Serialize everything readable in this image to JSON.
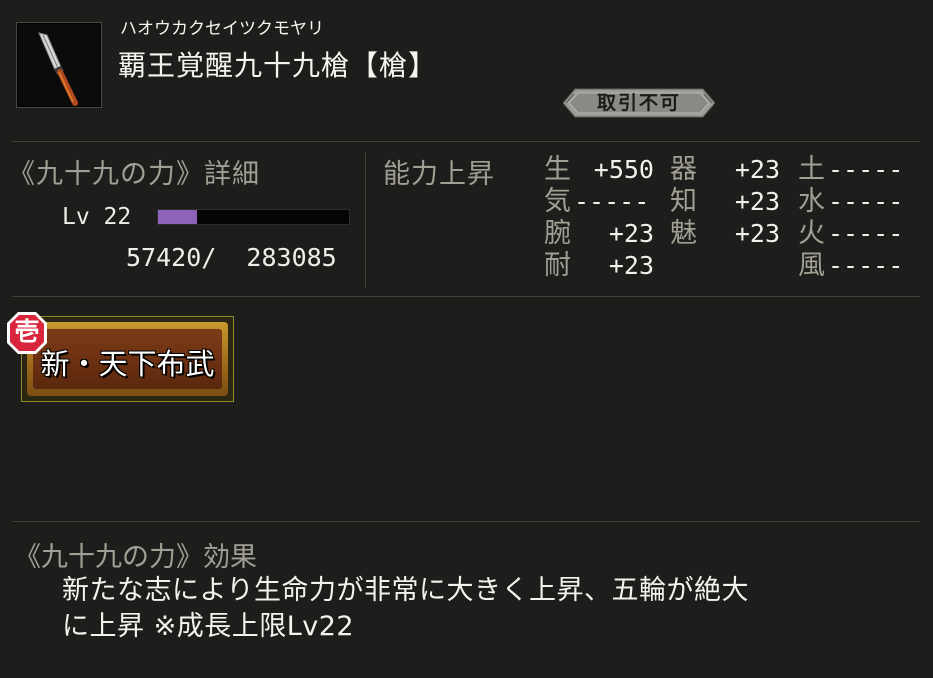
{
  "item": {
    "furigana": "ハオウカクセイツクモヤリ",
    "name": "覇王覚醒九十九槍【槍】",
    "icon": "spear-icon",
    "trade_status": "取引不可"
  },
  "power": {
    "title": "《九十九の力》詳細",
    "level_label": "Lv 22",
    "exp_text": "57420/  283085",
    "exp_current": 57420,
    "exp_max": 283085
  },
  "stats": {
    "title": "能力上昇",
    "col1": [
      {
        "name": "生",
        "value": "+550"
      },
      {
        "name": "気",
        "value": "-----"
      },
      {
        "name": "腕",
        "value": "+23"
      },
      {
        "name": "耐",
        "value": "+23"
      }
    ],
    "col2": [
      {
        "name": "器",
        "value": "+23"
      },
      {
        "name": "知",
        "value": "+23"
      },
      {
        "name": "魅",
        "value": "+23"
      }
    ],
    "col3": [
      {
        "name": "土",
        "value": "-----"
      },
      {
        "name": "水",
        "value": "-----"
      },
      {
        "name": "火",
        "value": "-----"
      },
      {
        "name": "風",
        "value": "-----"
      }
    ]
  },
  "skill": {
    "rank": "壱",
    "label": "新・天下布武"
  },
  "effect": {
    "title": "《九十九の力》効果",
    "line1": "新たな志により生命力が非常に大きく上昇、五輪が絶大",
    "line2": "に上昇 ※成長上限Lv22"
  },
  "colors": {
    "background": "#1d1d1b",
    "section_title": "#a19f93",
    "exp_bar": "#8c63b8",
    "skill_frame": "#c79a2e",
    "rank_badge": "#d9263c"
  }
}
